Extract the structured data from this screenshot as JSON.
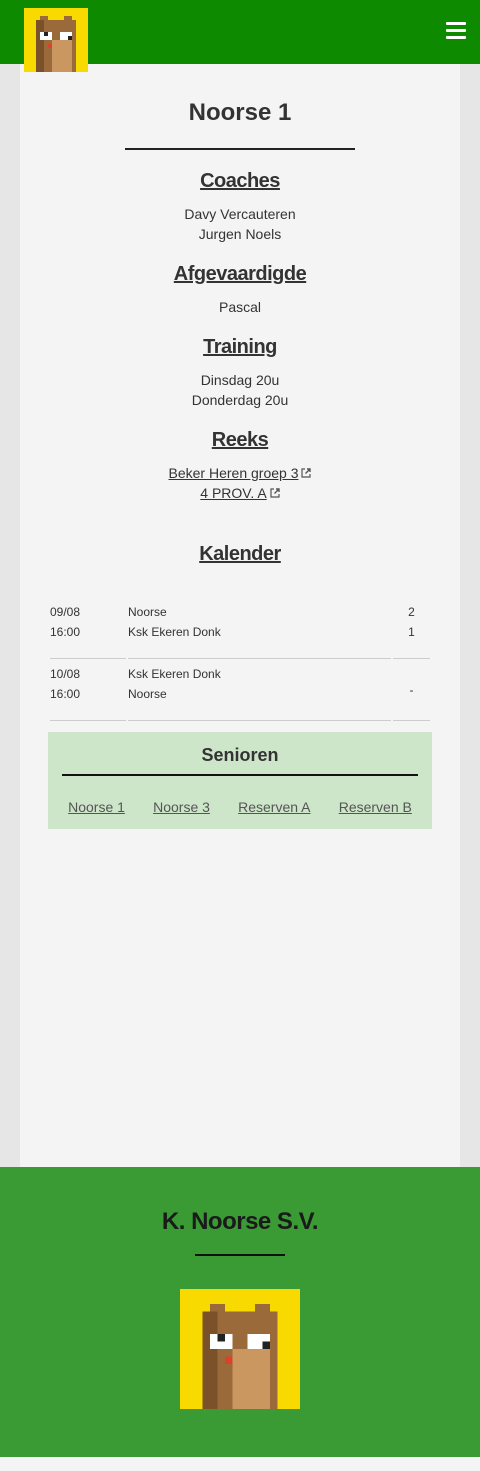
{
  "header": {
    "logo_icon": "pixel-marmot-logo",
    "menu_icon": "hamburger-menu-icon",
    "bar_color": "#0e8a00"
  },
  "team": {
    "title": "Noorse 1",
    "coaches": {
      "heading": "Coaches",
      "names": [
        "Davy Vercauteren",
        "Jurgen Noels"
      ]
    },
    "delegate": {
      "heading": "Afgevaardigde",
      "names": [
        "Pascal"
      ]
    },
    "training": {
      "heading": "Training",
      "times": [
        "Dinsdag 20u",
        "Donderdag 20u"
      ]
    },
    "series": {
      "heading": "Reeks",
      "links": [
        "Beker Heren groep 3",
        "4 PROV. A"
      ]
    }
  },
  "calendar": {
    "heading": "Kalender",
    "matches": [
      {
        "date": "09/08",
        "time": "16:00",
        "home": "Noorse",
        "away": "Ksk Ekeren Donk",
        "home_score": "2",
        "away_score": "1"
      },
      {
        "date": "10/08",
        "time": "16:00",
        "home": "Ksk Ekeren Donk",
        "away": "Noorse",
        "score": "-"
      }
    ]
  },
  "senioren": {
    "title": "Senioren",
    "links": [
      "Noorse 1",
      "Noorse 3",
      "Reserven A",
      "Reserven B"
    ],
    "box_color": "#cde6c9"
  },
  "footer": {
    "club_name": "K. Noorse S.V.",
    "logo_icon": "pixel-marmot-logo",
    "bg_color": "#3a9b35"
  }
}
